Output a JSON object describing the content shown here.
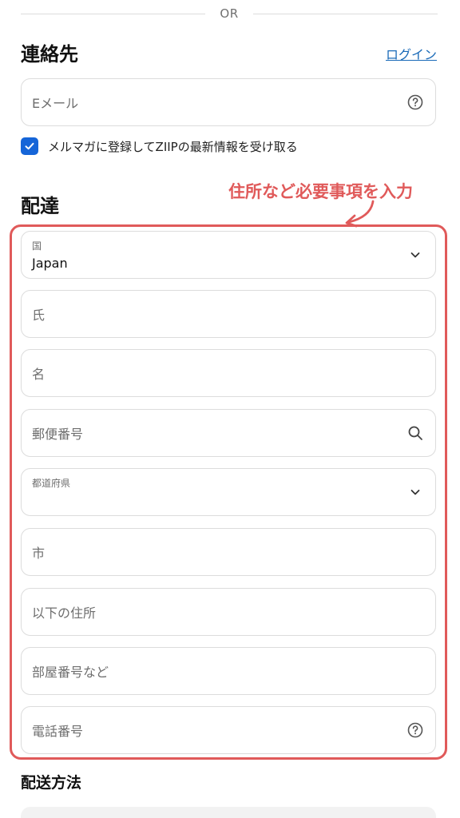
{
  "divider": {
    "or_text": "OR"
  },
  "contact": {
    "title": "連絡先",
    "login_link": "ログイン",
    "email_placeholder": "Eメール",
    "newsletter_label": "メルマガに登録してZIIPの最新情報を受け取る",
    "newsletter_checked": true
  },
  "delivery": {
    "title": "配達",
    "annotation": "住所など必要事項を入力",
    "country": {
      "label": "国",
      "value": "Japan"
    },
    "last_name_placeholder": "氏",
    "first_name_placeholder": "名",
    "postal_code_placeholder": "郵便番号",
    "prefecture": {
      "label": "都道府県",
      "value": ""
    },
    "city_placeholder": "市",
    "address_placeholder": "以下の住所",
    "apartment_placeholder": "部屋番号など",
    "phone_placeholder": "電話番号"
  },
  "shipping_method": {
    "title": "配送方法"
  },
  "colors": {
    "accent_blue": "#1565d8",
    "link_blue": "#1a6ab8",
    "annotation_red": "#e05a5a",
    "border_gray": "#dcdcdc"
  },
  "icons": {
    "email_help": "question-circle-icon",
    "checkbox": "checkmark-icon",
    "country_select": "chevron-down-icon",
    "postal_search": "search-icon",
    "prefecture_select": "chevron-down-icon",
    "phone_help": "question-circle-icon",
    "annotation": "curved-arrow-icon"
  }
}
